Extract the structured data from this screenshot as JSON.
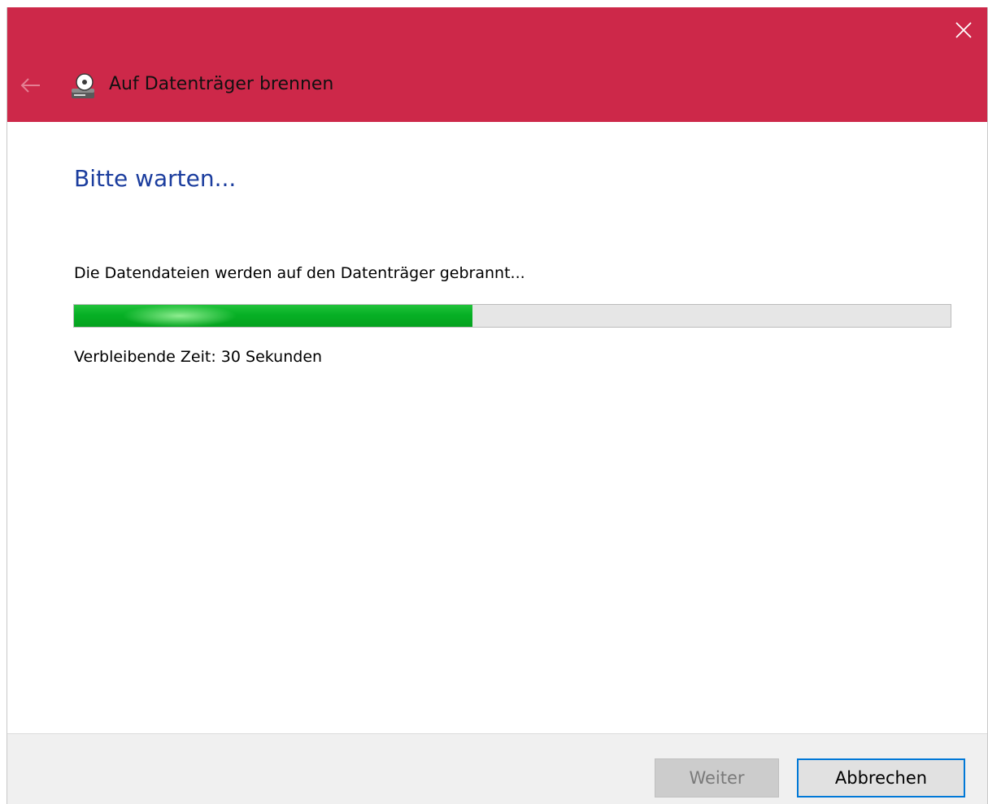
{
  "window": {
    "title": "Auf Datenträger brennen",
    "title_bar_color": "#cd2849"
  },
  "icons": {
    "close": "close-icon",
    "back": "arrow-left-icon",
    "title": "disc-burn-icon"
  },
  "content": {
    "heading": "Bitte warten...",
    "status": "Die Datendateien werden auf den Datenträger gebrannt...",
    "progress_percent": 45.5,
    "time_remaining": "Verbleibende Zeit: 30 Sekunden"
  },
  "buttons": {
    "next_label": "Weiter",
    "next_enabled": false,
    "cancel_label": "Abbrechen"
  }
}
